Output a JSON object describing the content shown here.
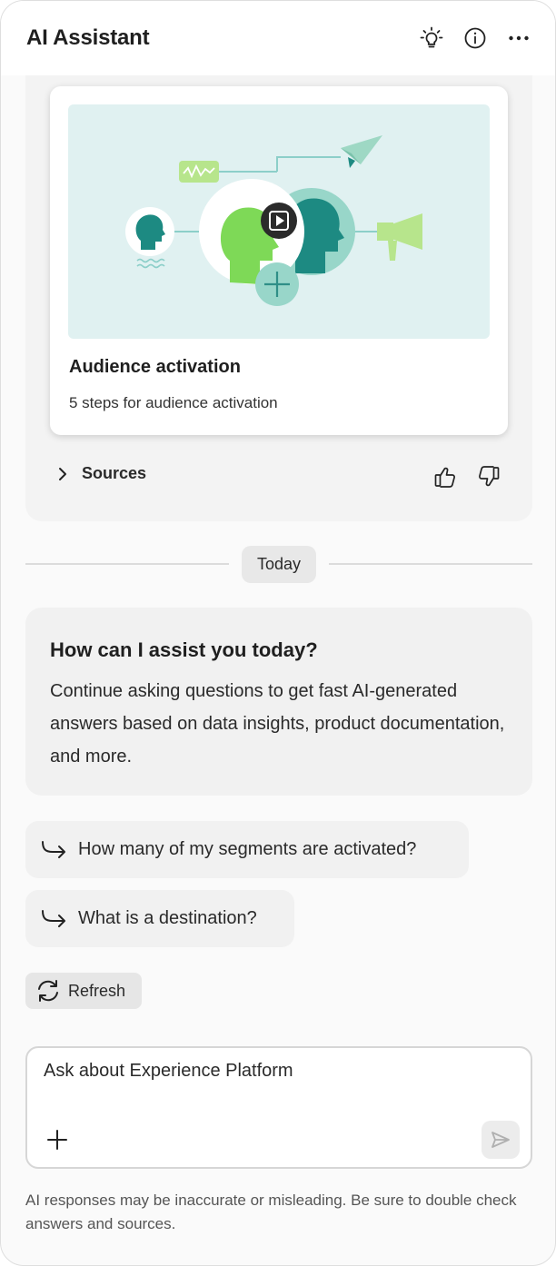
{
  "header": {
    "title": "AI Assistant",
    "actions": [
      "lightbulb-icon",
      "info-icon",
      "more-icon"
    ]
  },
  "answer": {
    "card": {
      "title": "Audience activation",
      "subtitle": "5 steps for audience activation"
    },
    "sources_label": "Sources"
  },
  "divider": {
    "label": "Today"
  },
  "welcome": {
    "title": "How can I assist you today?",
    "body": "Continue asking questions to get fast AI-generated answers based on data insights, product documentation, and more."
  },
  "suggestions": [
    {
      "label": "How many of my segments are activated?"
    },
    {
      "label": "What is a destination?"
    }
  ],
  "refresh": {
    "label": "Refresh"
  },
  "composer": {
    "placeholder": "Ask about Experience Platform"
  },
  "disclaimer": "AI responses may be inaccurate or misleading. Be sure to double check answers and sources.",
  "colors": {
    "illustration_bg": "#e0f1f1",
    "green": "#7ed957",
    "teal": "#1d8a82",
    "light_teal": "#98d6c9"
  }
}
